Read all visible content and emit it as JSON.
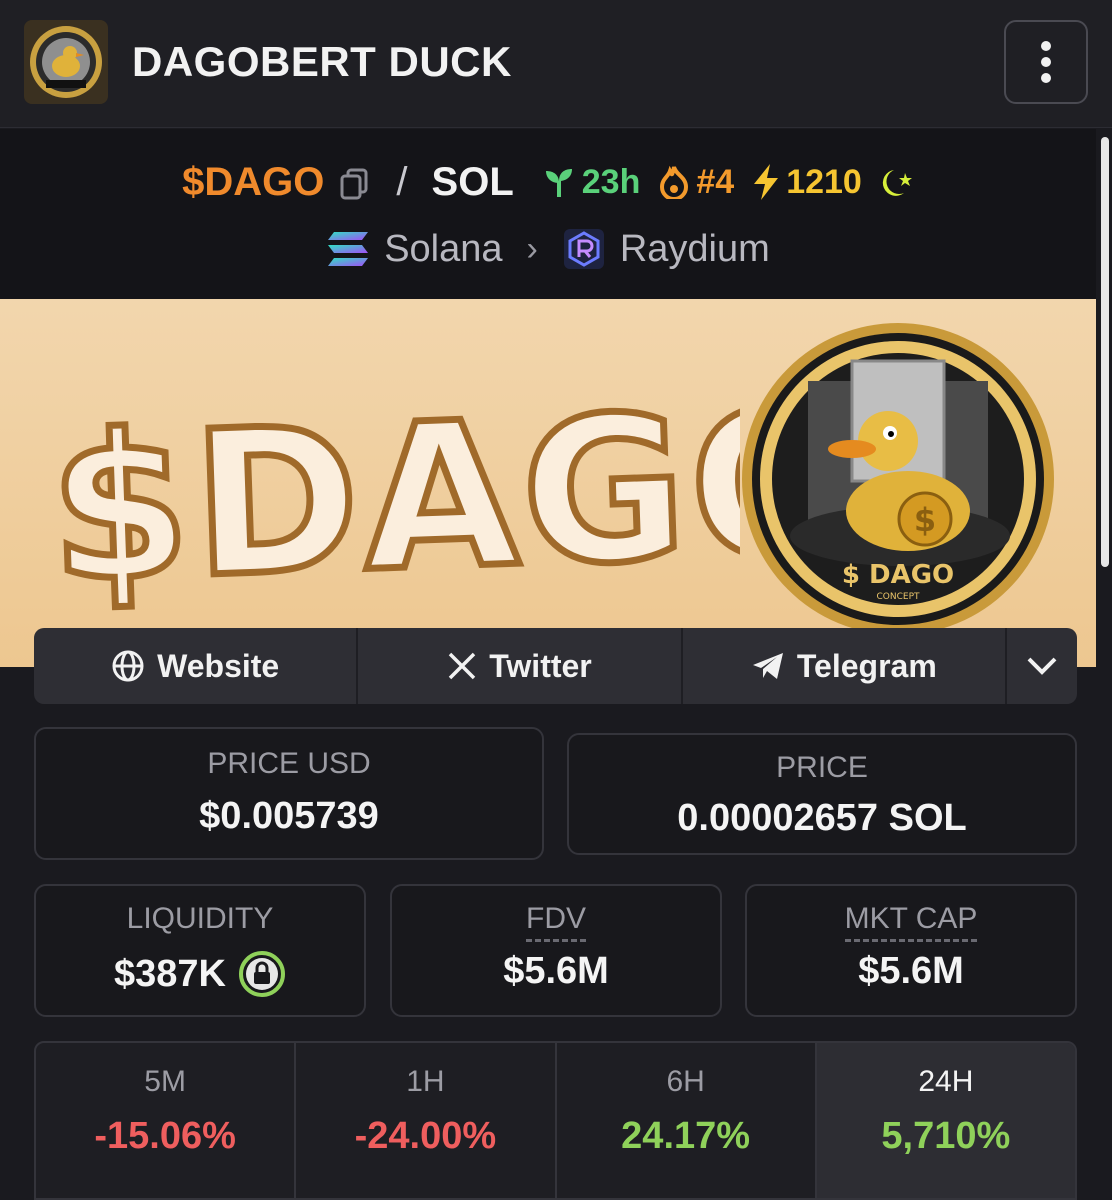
{
  "header": {
    "title": "DAGOBERT DUCK",
    "logo_icon": "dago-coin-logo",
    "menu_icon": "more-vertical-icon"
  },
  "pair": {
    "base_symbol": "$DAGO",
    "separator": "/",
    "quote_symbol": "SOL",
    "age": "23h",
    "rank": "#4",
    "boosts": "1210",
    "chain": "Solana",
    "dex": "Raydium",
    "colors": {
      "base": "#f08a2c",
      "age": "#5ad17a",
      "rank": "#f39a2c",
      "boosts": "#f6c531"
    }
  },
  "banner": {
    "headline": "$DAGO",
    "coin_text": "$ DAGO",
    "coin_subtext": "CONCEPT"
  },
  "links": [
    {
      "label": "Website",
      "icon": "globe-icon"
    },
    {
      "label": "Twitter",
      "icon": "x-logo-icon"
    },
    {
      "label": "Telegram",
      "icon": "telegram-icon"
    }
  ],
  "stats": {
    "price_usd": {
      "label": "PRICE USD",
      "value": "$0.005739"
    },
    "price_native": {
      "label": "PRICE",
      "value": "0.00002657 SOL"
    },
    "liquidity": {
      "label": "LIQUIDITY",
      "value": "$387K"
    },
    "fdv": {
      "label": "FDV",
      "value": "$5.6M"
    },
    "mkt_cap": {
      "label": "MKT CAP",
      "value": "$5.6M"
    }
  },
  "changes": [
    {
      "period": "5M",
      "value": "-15.06%",
      "color": "#ef5e5e"
    },
    {
      "period": "1H",
      "value": "-24.00%",
      "color": "#ef5e5e"
    },
    {
      "period": "6H",
      "value": "24.17%",
      "color": "#8fd15a"
    },
    {
      "period": "24H",
      "value": "5,710%",
      "color": "#8fd15a"
    }
  ]
}
